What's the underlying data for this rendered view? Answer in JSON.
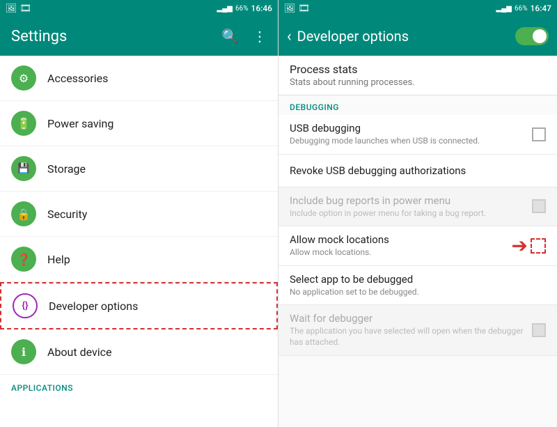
{
  "left": {
    "statusBar": {
      "leftIcons": "📷 🎞",
      "signal": "📶",
      "battery": "66%",
      "time": "16:46"
    },
    "topBar": {
      "title": "Settings",
      "searchIcon": "🔍",
      "moreIcon": "⋮"
    },
    "items": [
      {
        "id": "accessories",
        "label": "Accessories",
        "iconColor": "green",
        "iconSymbol": "🔗"
      },
      {
        "id": "power-saving",
        "label": "Power saving",
        "iconColor": "green",
        "iconSymbol": "🔋"
      },
      {
        "id": "storage",
        "label": "Storage",
        "iconColor": "green",
        "iconSymbol": "💾"
      },
      {
        "id": "security",
        "label": "Security",
        "iconColor": "green",
        "iconSymbol": "🔒"
      },
      {
        "id": "help",
        "label": "Help",
        "iconColor": "green",
        "iconSymbol": "❓"
      },
      {
        "id": "developer-options",
        "label": "Developer options",
        "iconColor": "purple",
        "iconSymbol": "{}",
        "highlighted": true
      },
      {
        "id": "about-device",
        "label": "About device",
        "iconColor": "green",
        "iconSymbol": "ℹ"
      }
    ],
    "sectionHeader": "APPLICATIONS"
  },
  "right": {
    "statusBar": {
      "leftIcons": "📷 🎞",
      "signal": "📶",
      "battery": "66%",
      "time": "16:47"
    },
    "topBar": {
      "backLabel": "‹",
      "title": "Developer options"
    },
    "partialItem": {
      "title": "Process stats",
      "sub": "Stats about running processes."
    },
    "sectionHeader": "DEBUGGING",
    "items": [
      {
        "id": "usb-debugging",
        "title": "USB debugging",
        "sub": "Debugging mode launches when USB is connected.",
        "hasCheckbox": true,
        "dimmed": false,
        "highlighted": false
      },
      {
        "id": "revoke-usb",
        "title": "Revoke USB debugging authorizations",
        "sub": "",
        "hasCheckbox": false,
        "dimmed": false,
        "highlighted": false,
        "revoke": true
      },
      {
        "id": "bug-reports",
        "title": "Include bug reports in power menu",
        "sub": "Include option in power menu for taking a bug report.",
        "hasCheckbox": true,
        "dimmed": true,
        "highlighted": false
      },
      {
        "id": "mock-locations",
        "title": "Allow mock locations",
        "sub": "Allow mock locations.",
        "hasCheckbox": true,
        "dimmed": false,
        "highlighted": true
      },
      {
        "id": "select-app-debug",
        "title": "Select app to be debugged",
        "sub": "No application set to be debugged.",
        "hasCheckbox": false,
        "dimmed": false,
        "highlighted": false
      },
      {
        "id": "wait-debugger",
        "title": "Wait for debugger",
        "sub": "The application you have selected will open when the debugger has attached.",
        "hasCheckbox": true,
        "dimmed": true,
        "highlighted": false
      }
    ]
  }
}
